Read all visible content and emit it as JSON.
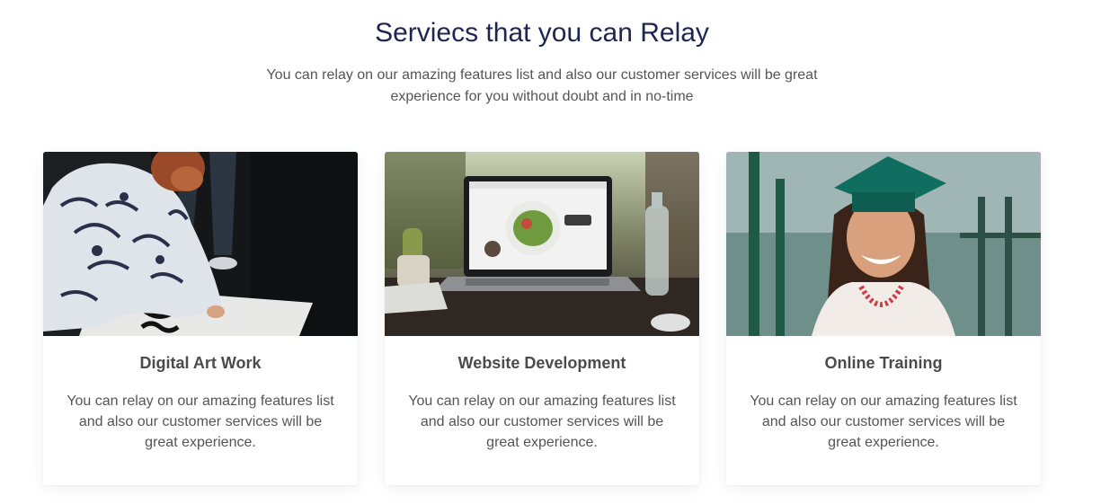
{
  "section": {
    "title": "Serviecs that you can Relay",
    "subtitle": "You can relay on our amazing features list and also our customer services will be great experience for you without doubt and in no-time"
  },
  "cards": [
    {
      "title": "Digital Art Work",
      "text": "You can relay on our amazing features list and also our customer services will be great experience.",
      "image_icon": "artist-photo"
    },
    {
      "title": "Website Development",
      "text": "You can relay on our amazing features list and also our customer services will be great experience.",
      "image_icon": "laptop-photo"
    },
    {
      "title": "Online Training",
      "text": "You can relay on our amazing features list and also our customer services will be great experience.",
      "image_icon": "graduate-photo"
    }
  ],
  "colors": {
    "title": "#1f2552",
    "text": "#555555",
    "card_title": "#4b4b4b",
    "background": "#ffffff"
  }
}
